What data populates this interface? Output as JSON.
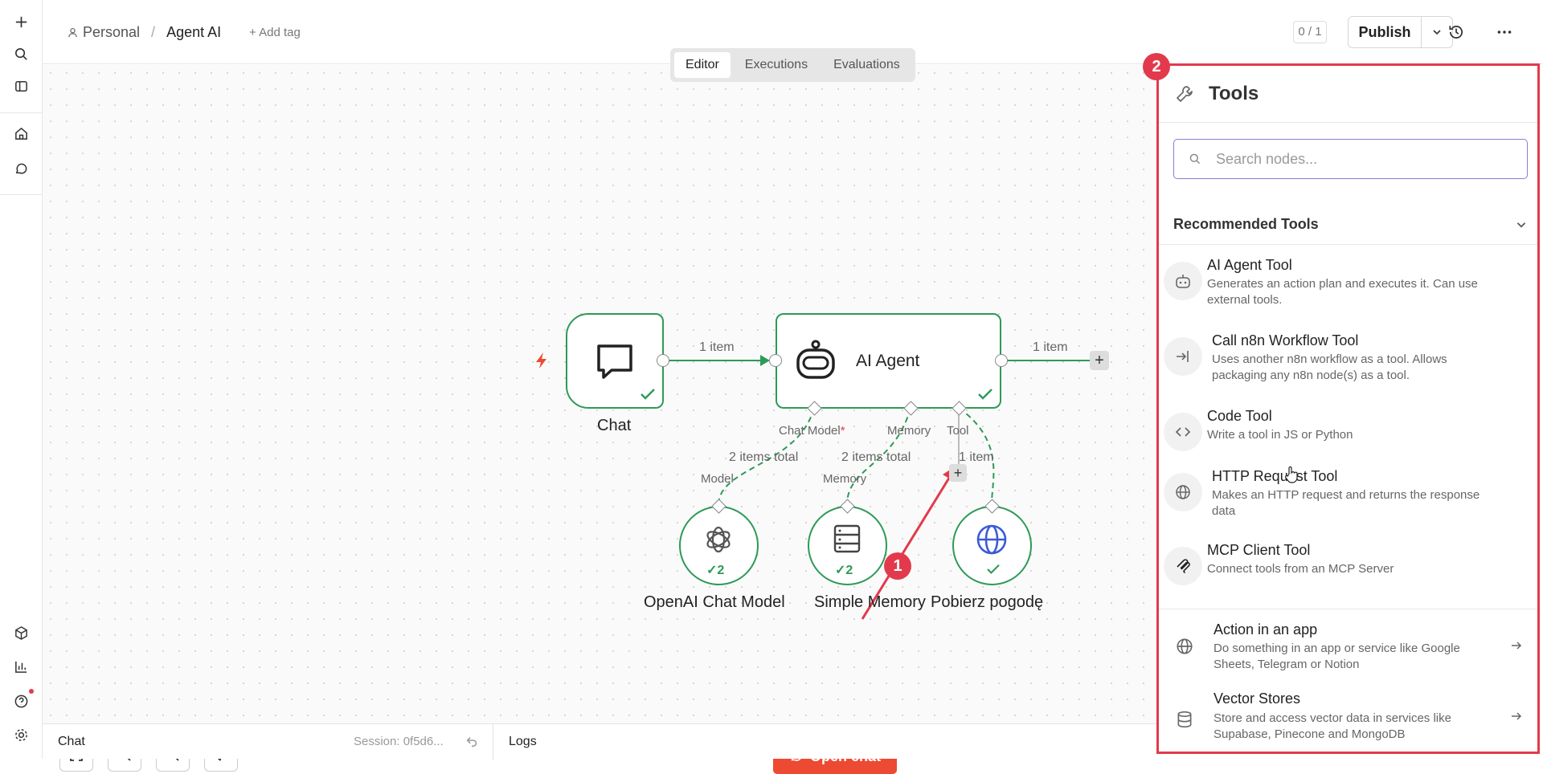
{
  "header": {
    "breadcrumb_root": "Personal",
    "breadcrumb_sep": "/",
    "workflow_name": "Agent AI",
    "add_tag": "+ Add tag",
    "counter": "0 / 1",
    "publish_label": "Publish"
  },
  "tabs": [
    {
      "label": "Editor",
      "active": true
    },
    {
      "label": "Executions",
      "active": false
    },
    {
      "label": "Evaluations",
      "active": false
    }
  ],
  "sidebar": {
    "icons": [
      "plus-icon",
      "search-icon",
      "panel-icon",
      "home-icon",
      "chat-icon",
      "cube-icon",
      "chart-icon",
      "help-icon",
      "settings-icon"
    ]
  },
  "canvas": {
    "nodes": {
      "chat": "Chat",
      "agent": "AI Agent",
      "openai": "OpenAI Chat Model",
      "memory": "Simple Memory",
      "weather": "Pobierz pogodę"
    },
    "edges": {
      "chat_to_agent": "1 item",
      "agent_out": "1 item",
      "model_items": "2 items total",
      "memory_items": "2 items total",
      "tool_items": "1 item"
    },
    "ports": {
      "chat_model": "Chat Model",
      "required_mark": "*",
      "memory": "Memory",
      "tool": "Tool",
      "model": "Model",
      "memory_in": "Memory"
    },
    "badges": {
      "openai_count": "2",
      "memory_count": "2",
      "marker_1": "1",
      "marker_2": "2"
    },
    "open_chat": "Open chat"
  },
  "bottombar": {
    "chat_label": "Chat",
    "session": "Session: 0f5d6...",
    "logs_label": "Logs"
  },
  "panel": {
    "title": "Tools",
    "search_placeholder": "Search nodes...",
    "section_title": "Recommended Tools",
    "items": [
      {
        "title": "AI Agent Tool",
        "desc": "Generates an action plan and executes it. Can use external tools."
      },
      {
        "title": "Call n8n Workflow Tool",
        "desc": "Uses another n8n workflow as a tool. Allows packaging any n8n node(s) as a tool."
      },
      {
        "title": "Code Tool",
        "desc": "Write a tool in JS or Python"
      },
      {
        "title": "HTTP Request Tool",
        "desc": "Makes an HTTP request and returns the response data"
      },
      {
        "title": "MCP Client Tool",
        "desc": "Connect tools from an MCP Server"
      }
    ],
    "bottom_items": [
      {
        "title": "Action in an app",
        "desc": "Do something in an app or service like Google Sheets, Telegram or Notion"
      },
      {
        "title": "Vector Stores",
        "desc": "Store and access vector data in services like Supabase, Pinecone and MongoDB"
      }
    ]
  },
  "colors": {
    "accent_green": "#2d9a57",
    "annotation_red": "#e23a4c",
    "open_chat_bg": "#ec4a32",
    "search_border": "#8a7cd9"
  }
}
